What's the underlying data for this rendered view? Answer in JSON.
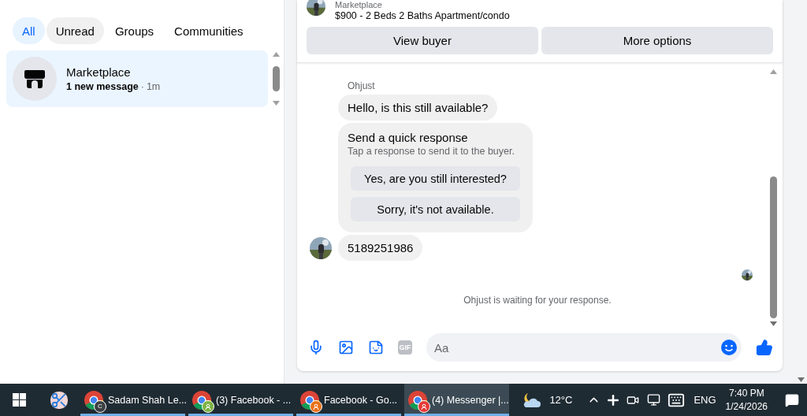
{
  "sidebar": {
    "tabs": [
      {
        "label": "All",
        "selected": true,
        "hovered": false
      },
      {
        "label": "Unread",
        "selected": false,
        "hovered": true
      },
      {
        "label": "Groups",
        "selected": false,
        "hovered": false
      },
      {
        "label": "Communities",
        "selected": false,
        "hovered": false
      }
    ],
    "chats": [
      {
        "name": "Marketplace",
        "preview": "1 new message",
        "separator": "·",
        "time": "1m",
        "selected": true
      }
    ]
  },
  "listing": {
    "category": "Marketplace",
    "title": "$900 - 2 Beds 2 Baths Apartment/condo",
    "buttons": [
      "View buyer",
      "More options"
    ]
  },
  "messages": [
    {
      "kind": "sender",
      "text": "Ohjust"
    },
    {
      "kind": "bubble",
      "text": "Hello, is this still available?",
      "avatar": false
    },
    {
      "kind": "quick_reply",
      "title": "Send a quick response",
      "subtitle": "Tap a response to send it to the buyer.",
      "options": [
        "Yes, are you still interested?",
        "Sorry, it's not available."
      ]
    },
    {
      "kind": "bubble",
      "text": "5189251986",
      "avatar": true
    },
    {
      "kind": "seen"
    },
    {
      "kind": "notice",
      "text": "Ohjust is waiting for your response."
    }
  ],
  "composer": {
    "placeholder": "Aa",
    "gif_label": "GIF"
  },
  "taskbar": {
    "apps": [
      {
        "kind": "snip",
        "selected": false
      },
      {
        "kind": "chrome",
        "label": "Sadam Shah Le...",
        "selected": false,
        "badge": {
          "kind": "letter",
          "text": "C",
          "color": "#3c4043"
        }
      },
      {
        "kind": "chrome",
        "label": "(3) Facebook - ...",
        "selected": false,
        "badge": {
          "kind": "profile",
          "color": "#7cb342"
        }
      },
      {
        "kind": "chrome",
        "label": "Facebook - Go...",
        "selected": false,
        "badge": {
          "kind": "profile",
          "color": "#e8711a"
        }
      },
      {
        "kind": "chrome",
        "label": "(4) Messenger |...",
        "selected": true,
        "badge": {
          "kind": "profile",
          "color": "#e53935"
        }
      }
    ],
    "temperature": "12°C",
    "language": "ENG",
    "time": "7:40 PM",
    "date": "1/24/2026"
  }
}
